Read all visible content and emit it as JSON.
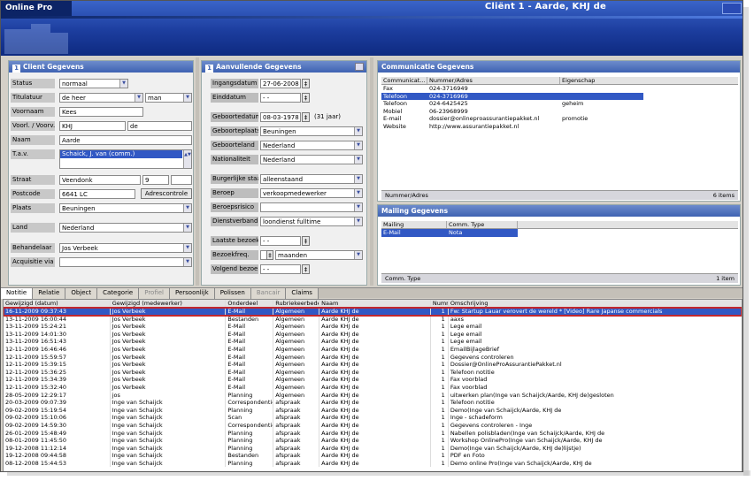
{
  "app": {
    "name": "Online Pro",
    "client_title": "Cliënt 1  -  Aarde, KHJ de"
  },
  "client": {
    "title": "Client Gegevens",
    "status": {
      "label": "Status",
      "value": "normaal"
    },
    "titulatuur": {
      "label": "Titulatuur",
      "value": "de heer",
      "gender": "man"
    },
    "voornaam": {
      "label": "Voornaam",
      "value": "Kees"
    },
    "voorl": {
      "label": "Voorl. / Voorv.",
      "value": "KHJ",
      "voorv": "de"
    },
    "naam": {
      "label": "Naam",
      "value": "Aarde"
    },
    "tav": {
      "label": "T.a.v.",
      "value": "Schaick, J. van (comm.)"
    },
    "straat": {
      "label": "Straat",
      "value": "Veendonk",
      "nr": "9"
    },
    "postcode": {
      "label": "Postcode",
      "value": "6641 LC",
      "button": "Adrescontrole"
    },
    "plaats": {
      "label": "Plaats",
      "value": "Beuningen"
    },
    "land": {
      "label": "Land",
      "value": "Nederland"
    },
    "behandelaar": {
      "label": "Behandelaar",
      "value": "Jos Verbeek"
    },
    "acquisitie": {
      "label": "Acquisitie via",
      "value": ""
    }
  },
  "aanvul": {
    "title": "Aanvullende Gegevens",
    "ingangsdatum": {
      "label": "Ingangsdatum",
      "value": "27-06-2008"
    },
    "einddatum": {
      "label": "Einddatum",
      "value": "-  -"
    },
    "geboortedatum": {
      "label": "Geboortedatum",
      "value": "08-03-1978",
      "age": "(31 jaar)"
    },
    "geboorteplaats": {
      "label": "Geboorteplaats",
      "value": "Beuningen"
    },
    "geboorteland": {
      "label": "Geboorteland",
      "value": "Nederland"
    },
    "nationaliteit": {
      "label": "Nationaliteit",
      "value": "Nederland"
    },
    "burgerlijke": {
      "label": "Burgerlijke staat",
      "value": "alleenstaand"
    },
    "beroep": {
      "label": "Beroep",
      "value": "verkoopmedewerker"
    },
    "beroepsrisico": {
      "label": "Beroepsrisico",
      "value": ""
    },
    "dienstverband": {
      "label": "Dienstverband",
      "value": "loondienst fulltime"
    },
    "laatste_bezoek": {
      "label": "Laatste bezoek",
      "value": "-  -"
    },
    "bezoekfreq": {
      "label": "Bezoekfreq.",
      "value": "maanden"
    },
    "volgend_bezoek": {
      "label": "Volgend bezoek",
      "value": "-  -"
    }
  },
  "comm": {
    "title": "Communicatie Gegevens",
    "headers": [
      "Communicat...",
      "Nummer/Adres",
      "Eigenschap"
    ],
    "rows": [
      [
        "Fax",
        "024-3716949",
        ""
      ],
      [
        "Telefoon",
        "024-3716969",
        ""
      ],
      [
        "Telefoon",
        "024-6425425",
        "geheim"
      ],
      [
        "Mobiel",
        "06-23968999",
        ""
      ],
      [
        "E-mail",
        "dossier@onlineproassurantiepakket.nl",
        "promotie"
      ],
      [
        "Website",
        "http://www.assurantiepakket.nl",
        ""
      ]
    ],
    "footer_left": "Nummer/Adres",
    "footer_right": "6 items"
  },
  "mailing": {
    "title": "Mailing Gegevens",
    "headers": [
      "Mailing",
      "Comm. Type"
    ],
    "rows": [
      [
        "E-Mail",
        "Nota"
      ]
    ],
    "footer_left": "Comm. Type",
    "footer_right": "1 item"
  },
  "tabs": [
    "Notitie",
    "Relatie",
    "Object",
    "Categorie",
    "Profiel",
    "Persoonlijk",
    "Polissen",
    "Bancair",
    "Claims"
  ],
  "notes": {
    "headers": [
      "Gewijzigd (datum)",
      "Gewijzigd (medewerker)",
      "Onderdeel",
      "Rubriekeerbeden",
      "Naam",
      "Nummer",
      "Omschrijving"
    ],
    "rows": [
      [
        "16-11-2009 09:37:43",
        "Jos Verbeek",
        "E-Mail",
        "Algemeen",
        "Aarde KHJ de",
        "1",
        "Fw: Startup Lauar verovert de wereld * [Video] Rare Japanse commercials"
      ],
      [
        "13-11-2009 16:00:44",
        "Jos Verbeek",
        "Bestanden",
        "Algemeen",
        "Aarde KHJ de",
        "1",
        "aaxs"
      ],
      [
        "13-11-2009 15:24:21",
        "Jos Verbeek",
        "E-Mail",
        "Algemeen",
        "Aarde KHJ de",
        "1",
        "Lege email"
      ],
      [
        "13-11-2009 14:01:30",
        "Jos Verbeek",
        "E-Mail",
        "Algemeen",
        "Aarde KHJ de",
        "1",
        "Lege email"
      ],
      [
        "13-11-2009 16:51:43",
        "Jos Verbeek",
        "E-Mail",
        "Algemeen",
        "Aarde KHJ de",
        "1",
        "Lege email"
      ],
      [
        "12-11-2009 16:46:46",
        "Jos Verbeek",
        "E-Mail",
        "Algemeen",
        "Aarde KHJ de",
        "1",
        "EmailBijlageBrief"
      ],
      [
        "12-11-2009 15:59:57",
        "Jos Verbeek",
        "E-Mail",
        "Algemeen",
        "Aarde KHJ de",
        "1",
        "Gegevens controleren"
      ],
      [
        "12-11-2009 15:39:15",
        "Jos Verbeek",
        "E-Mail",
        "Algemeen",
        "Aarde KHJ de",
        "1",
        "Dossier@OnlineProAssurantiePakket.nl"
      ],
      [
        "12-11-2009 15:36:25",
        "Jos Verbeek",
        "E-Mail",
        "Algemeen",
        "Aarde KHJ de",
        "1",
        "Telefoon notitie"
      ],
      [
        "12-11-2009 15:34:39",
        "Jos Verbeek",
        "E-Mail",
        "Algemeen",
        "Aarde KHJ de",
        "1",
        "Fax voorblad"
      ],
      [
        "12-11-2009 15:32:40",
        "Jos Verbeek",
        "E-Mail",
        "Algemeen",
        "Aarde KHJ de",
        "1",
        "Fax voorblad"
      ],
      [
        "28-05-2009 12:29:17",
        "jos",
        "Planning",
        "Algemeen",
        "Aarde KHJ de",
        "1",
        "uitwerken plan(Inge van Schaijck/Aarde, KHJ de)gesloten"
      ],
      [
        "20-03-2009 09:07:39",
        "Inge van Schaijck",
        "Correspondentie",
        "afspraak",
        "Aarde KHJ de",
        "1",
        "Telefoon notitie"
      ],
      [
        "09-02-2009 15:19:54",
        "Inge van Schaijck",
        "Planning",
        "afspraak",
        "Aarde KHJ de",
        "1",
        "Demo(Inge van Schaijck/Aarde, KHJ de"
      ],
      [
        "09-02-2009 15:10:06",
        "Inge van Schaijck",
        "Scan",
        "afspraak",
        "Aarde KHJ de",
        "1",
        "Inge - schadeform"
      ],
      [
        "09-02-2009 14:59:30",
        "Inge van Schaijck",
        "Correspondentie",
        "afspraak",
        "Aarde KHJ de",
        "1",
        "Gegevens controleren - Inge"
      ],
      [
        "26-01-2009 15:48:49",
        "Inge van Schaijck",
        "Planning",
        "afspraak",
        "Aarde KHJ de",
        "1",
        "Nabellen polisbladen(Inge van Schaijck/Aarde, KHJ de"
      ],
      [
        "08-01-2009 11:45:50",
        "Inge van Schaijck",
        "Planning",
        "afspraak",
        "Aarde KHJ de",
        "1",
        "Workshop OnlinePro(Inge van Schaijck/Aarde, KHJ de"
      ],
      [
        "19-12-2008 11:12:14",
        "Inge van Schaijck",
        "Planning",
        "afspraak",
        "Aarde KHJ de",
        "1",
        "Demo(Inge van Schaijck/Aarde, KHJ de)lijstje)"
      ],
      [
        "19-12-2008 09:44:58",
        "Inge van Schaijck",
        "Bestanden",
        "afspraak",
        "Aarde KHJ de",
        "1",
        "PDF en Foto"
      ],
      [
        "08-12-2008 15:44:53",
        "Inge van Schaijck",
        "Planning",
        "afspraak",
        "Aarde KHJ de",
        "1",
        "Demo online Pro(Inge van Schaijck/Aarde, KHJ de"
      ]
    ]
  }
}
